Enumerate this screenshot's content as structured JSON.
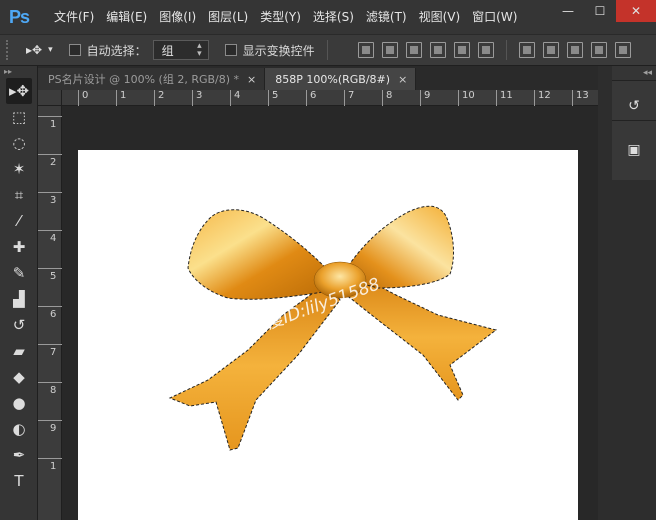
{
  "app": {
    "logo": "Ps"
  },
  "menu": {
    "items": [
      "文件(F)",
      "编辑(E)",
      "图像(I)",
      "图层(L)",
      "类型(Y)",
      "选择(S)",
      "滤镜(T)",
      "视图(V)",
      "窗口(W)"
    ]
  },
  "window_controls": {
    "minimize": "—",
    "maximize": "☐",
    "close": "✕"
  },
  "options": {
    "move_tool_glyph": "▸✥",
    "tool_dropdown": "▾",
    "auto_select_label": "自动选择：",
    "auto_select_value": "组",
    "show_transform_label": "显示变换控件"
  },
  "tabs": [
    {
      "label": "PS名片设计 @ 100% (组 2, RGB/8) *",
      "close": "×",
      "active": false
    },
    {
      "label": "858P          100%(RGB/8#)",
      "close": "×",
      "active": true
    }
  ],
  "ruler": {
    "h_labels": [
      "0",
      "1",
      "2",
      "3",
      "4",
      "5",
      "6",
      "7",
      "8",
      "9",
      "10",
      "11",
      "12",
      "13"
    ],
    "v_labels": [
      "1",
      "2",
      "3",
      "4",
      "5",
      "6",
      "7",
      "8",
      "9",
      "1"
    ]
  },
  "canvas": {
    "watermark": "百度ID:lily51588",
    "ribbon_color": "#e8961a",
    "ribbon_highlight": "#f8d070",
    "ribbon_shadow": "#b06a08"
  },
  "toolbox": {
    "head": "▸▸",
    "tools": [
      {
        "name": "move-tool",
        "glyph": "▸✥"
      },
      {
        "name": "marquee-tool",
        "glyph": "⬚"
      },
      {
        "name": "lasso-tool",
        "glyph": "◌"
      },
      {
        "name": "magic-wand-tool",
        "glyph": "✶"
      },
      {
        "name": "crop-tool",
        "glyph": "⌗"
      },
      {
        "name": "eyedropper-tool",
        "glyph": "⁄"
      },
      {
        "name": "healing-brush-tool",
        "glyph": "✚"
      },
      {
        "name": "brush-tool",
        "glyph": "✎"
      },
      {
        "name": "clone-stamp-tool",
        "glyph": "▟"
      },
      {
        "name": "history-brush-tool",
        "glyph": "↺"
      },
      {
        "name": "eraser-tool",
        "glyph": "▰"
      },
      {
        "name": "paint-bucket-tool",
        "glyph": "◆"
      },
      {
        "name": "blur-tool",
        "glyph": "●"
      },
      {
        "name": "dodge-tool",
        "glyph": "◐"
      },
      {
        "name": "pen-tool",
        "glyph": "✒"
      },
      {
        "name": "type-tool",
        "glyph": "T"
      }
    ]
  },
  "right_dock": {
    "collapse": "◂◂",
    "panels": [
      {
        "name": "history-panel-icon",
        "glyph": "↺"
      },
      {
        "name": "properties-panel-icon",
        "glyph": "▣"
      }
    ]
  }
}
